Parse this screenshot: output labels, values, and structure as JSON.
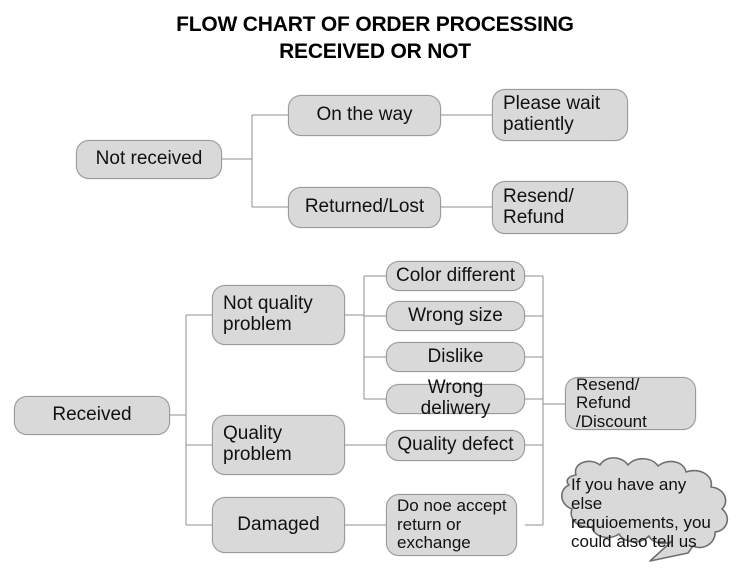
{
  "title": {
    "line1": "FLOW CHART OF ORDER PROCESSING",
    "line2": "RECEIVED OR NOT"
  },
  "colors": {
    "node_fill": "#d9d9d9",
    "node_border": "#9a9a9a",
    "connector": "#8f8f8f",
    "text": "#111111",
    "background": "#ffffff"
  },
  "branches": {
    "not_received": {
      "root": "Not received",
      "children": [
        {
          "label": "On the way",
          "outcome": "Please wait\npatiently"
        },
        {
          "label": "Returned/Lost",
          "outcome": "Resend/\nRefund"
        }
      ]
    },
    "received": {
      "root": "Received",
      "children": [
        {
          "label": "Not quality\nproblem",
          "reasons": [
            "Color different",
            "Wrong size",
            "Dislike",
            "Wrong deliwery"
          ]
        },
        {
          "label": "Quality\nproblem",
          "reasons": [
            "Quality defect"
          ]
        },
        {
          "label": "Damaged",
          "reasons": [
            "Do noe accept\nreturn or\nexchange"
          ]
        }
      ],
      "outcome": "Resend/ Refund\n/Discount"
    }
  },
  "callout": {
    "text": "If you have any else\nrequioements, you\ncould also tell us"
  }
}
